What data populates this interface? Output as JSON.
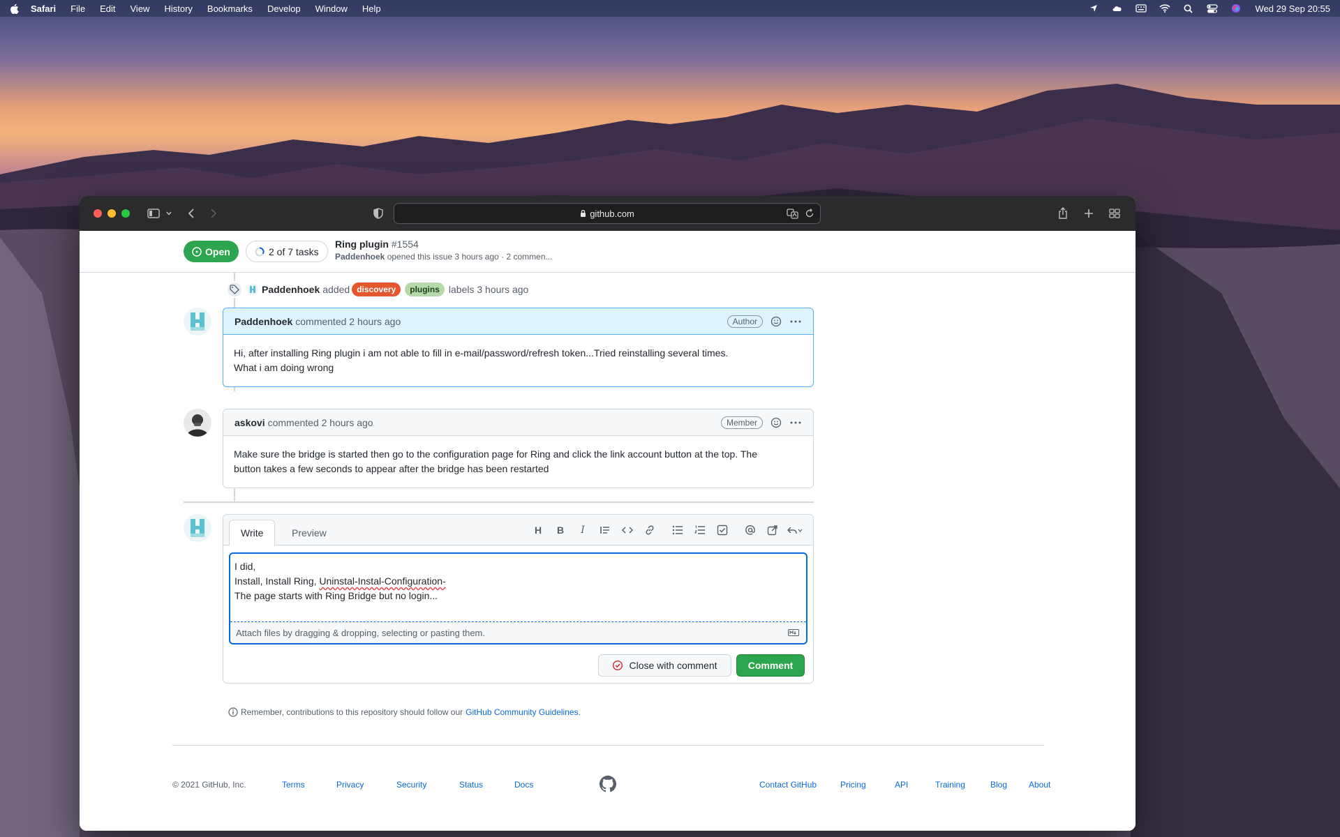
{
  "menubar": {
    "app": "Safari",
    "items": [
      "File",
      "Edit",
      "View",
      "History",
      "Bookmarks",
      "Develop",
      "Window",
      "Help"
    ],
    "clock": "Wed 29 Sep  20:55"
  },
  "browser": {
    "url": "github.com"
  },
  "issue": {
    "state": "Open",
    "tasks": "2 of 7 tasks",
    "title": "Ring plugin",
    "number": "#1554",
    "author": "Paddenhoek",
    "subtitle": "opened this issue 3 hours ago · 2 commen..."
  },
  "label_event": {
    "actor": "Paddenhoek",
    "verb": "added",
    "labels": [
      "discovery",
      "plugins"
    ],
    "suffix": "labels 3 hours ago"
  },
  "comments": [
    {
      "author": "Paddenhoek",
      "meta": "commented 2 hours ago",
      "role": "Author",
      "line1": "Hi, after installing Ring plugin i am not able to fill in e-mail/password/refresh token...Tried reinstalling several times.",
      "line2": "What i am doing wrong"
    },
    {
      "author": "askovi",
      "meta": "commented 2 hours ago",
      "role": "Member",
      "line1": "Make sure the bridge is started then go to the configuration page for Ring and click the link account button at the top. The",
      "line2": "button takes a few seconds to appear after the bridge has been restarted"
    }
  ],
  "composer": {
    "tab_write": "Write",
    "tab_preview": "Preview",
    "text_line1": "I did,",
    "text_line2a": "Install, Install Ring, ",
    "text_line2b": "Uninstal-Instal-Configuration-",
    "text_line3": "The page starts with Ring Bridge but no login...",
    "attach": "Attach files by dragging & dropping, selecting or pasting them.",
    "close_btn": "Close with comment",
    "comment_btn": "Comment",
    "heading_tool": "H",
    "bold_tool": "B",
    "italic_tool": "I"
  },
  "remember": {
    "text": "Remember, contributions to this repository should follow our",
    "link": "GitHub Community Guidelines",
    "end": "."
  },
  "footer": {
    "copyright": "© 2021 GitHub, Inc.",
    "links": [
      "Terms",
      "Privacy",
      "Security",
      "Status",
      "Docs",
      "Contact GitHub",
      "Pricing",
      "API",
      "Training",
      "Blog",
      "About"
    ]
  },
  "colors": {
    "open_green": "#2da44e",
    "label_discovery": "#e4572e",
    "label_plugins": "#b5d9a8",
    "link_blue": "#0969da"
  }
}
